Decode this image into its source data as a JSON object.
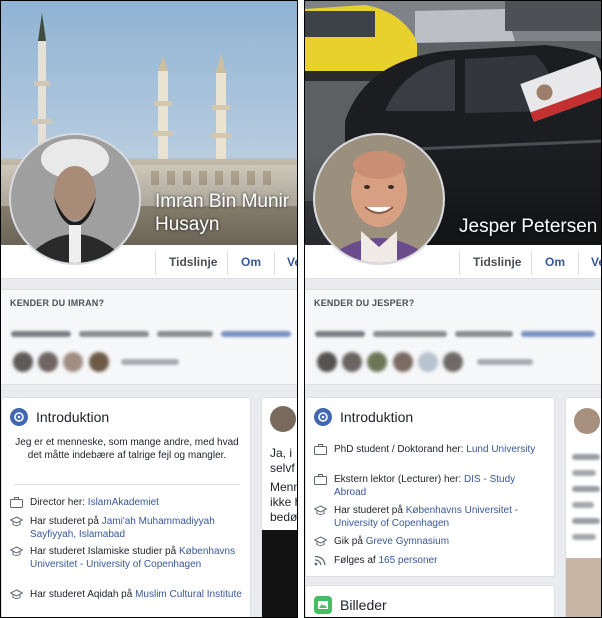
{
  "left": {
    "name": "Imran Bin Munir Husayn",
    "tabs": {
      "timeline": "Tidslinje",
      "about": "Om",
      "more": "Ve"
    },
    "know_title": "KENDER DU IMRAN?",
    "intro": {
      "title": "Introduktion",
      "bio": "Jeg er et menneske, som mange andre, med hvad det måtte indebære af talrige fejl og mangler.",
      "items": [
        {
          "icon": "briefcase-icon",
          "prefix": "Director her: ",
          "link": "IslamAkademiet"
        },
        {
          "icon": "graduation-cap-icon",
          "prefix": "Har studeret på ",
          "link": "Jami'ah Muhammadiyyah Sayfiyyah, Islamabad"
        },
        {
          "icon": "graduation-cap-icon",
          "prefix": "Har studeret Islamiske studier på ",
          "link": "Københavns Universitet - University of Copenhagen"
        },
        {
          "icon": "graduation-cap-icon",
          "prefix": "Har studeret Aqidah på ",
          "link": "Muslim Cultural Institute"
        }
      ]
    },
    "side_card": {
      "line1": "Ja, i",
      "line2": "selvf",
      "line3": "Menn",
      "line4": "ikke h",
      "line5": "bedø"
    }
  },
  "right": {
    "name": "Jesper Petersen",
    "tabs": {
      "timeline": "Tidslinje",
      "about": "Om",
      "more": "Ve"
    },
    "know_title": "KENDER DU JESPER?",
    "intro": {
      "title": "Introduktion",
      "items": [
        {
          "icon": "briefcase-icon",
          "prefix": "PhD student / Doktorand her: ",
          "link": "Lund University"
        },
        {
          "icon": "briefcase-icon",
          "prefix": "Ekstern lektor (Lecturer) her: ",
          "link": "DIS - Study Abroad"
        },
        {
          "icon": "graduation-cap-icon",
          "prefix": "Har studeret på ",
          "link": "Københavns Universitet - University of Copenhagen"
        },
        {
          "icon": "graduation-cap-icon",
          "prefix": "Gik på ",
          "link": "Greve Gymnasium"
        },
        {
          "icon": "rss-icon",
          "prefix": "Følges af ",
          "link": "165 personer"
        }
      ]
    },
    "photos": {
      "title": "Billeder"
    }
  },
  "colors": {
    "link": "#385898",
    "intro_icon": "#4267b2",
    "photos_icon": "#45bd62",
    "panel_bg": "#e9ebee"
  }
}
